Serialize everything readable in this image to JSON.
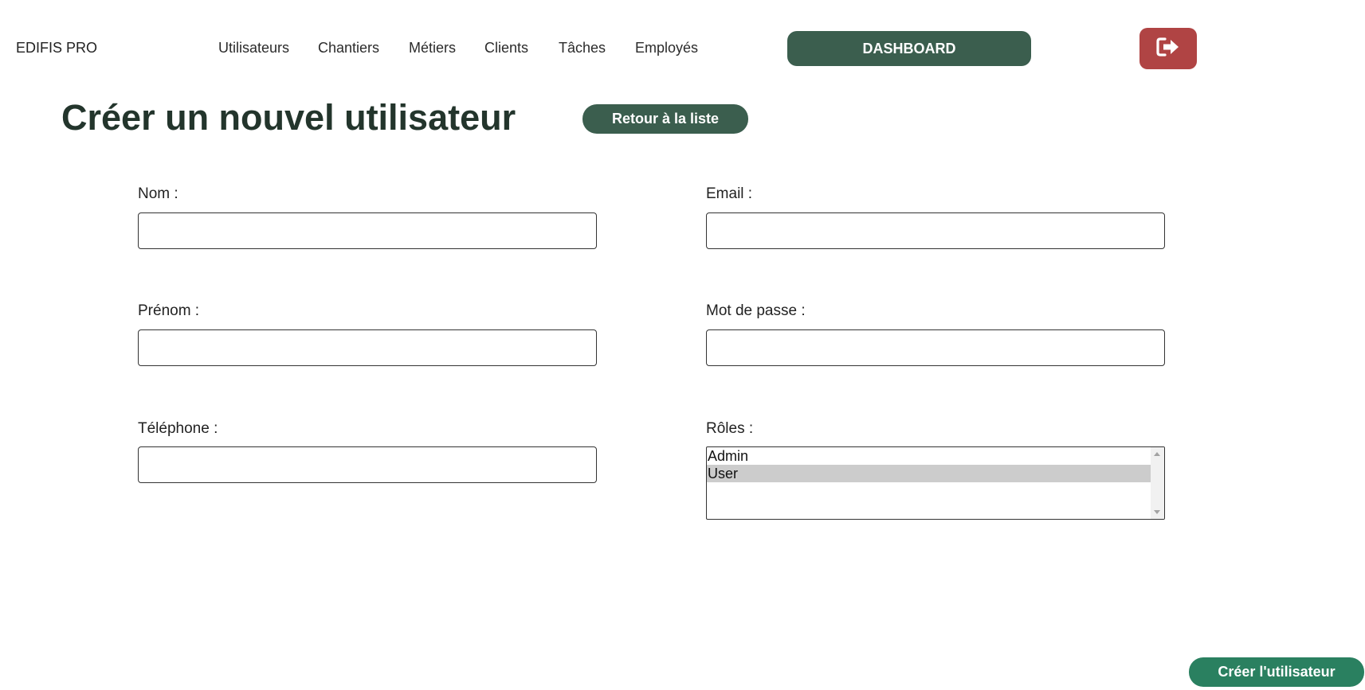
{
  "brand": "EDIFIS PRO",
  "nav": {
    "items": [
      {
        "label": "Utilisateurs"
      },
      {
        "label": "Chantiers"
      },
      {
        "label": "Métiers"
      },
      {
        "label": "Clients"
      },
      {
        "label": "Tâches"
      },
      {
        "label": "Employés"
      }
    ],
    "dashboard_label": "DASHBOARD",
    "logout_icon": "sign-out-icon"
  },
  "page": {
    "title": "Créer un nouvel utilisateur",
    "back_label": "Retour à la liste",
    "submit_label": "Créer l'utilisateur"
  },
  "form": {
    "nom": {
      "label": "Nom :",
      "value": ""
    },
    "prenom": {
      "label": "Prénom :",
      "value": ""
    },
    "telephone": {
      "label": "Téléphone :",
      "value": ""
    },
    "email": {
      "label": "Email :",
      "value": ""
    },
    "password": {
      "label": "Mot de passe :",
      "value": ""
    },
    "roles": {
      "label": "Rôles :",
      "options": [
        "Admin",
        "User"
      ],
      "selected": "User"
    }
  },
  "colors": {
    "primary": "#3b5e4e",
    "danger": "#b04444",
    "submit": "#2a8060",
    "title": "#23352c"
  }
}
